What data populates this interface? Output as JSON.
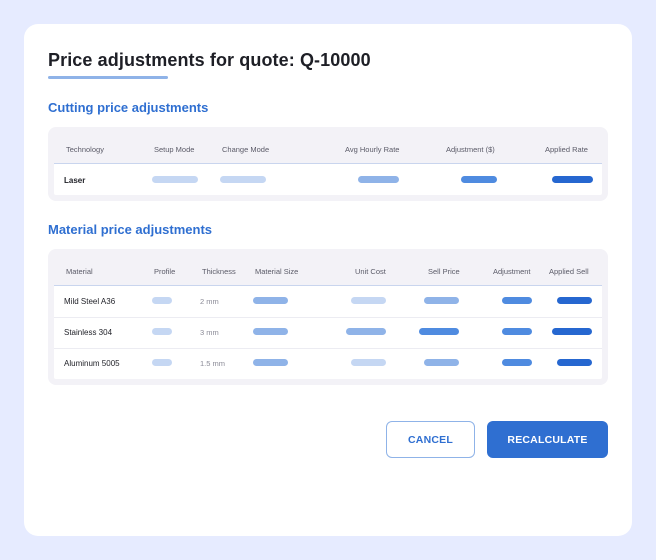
{
  "modal": {
    "title": "Price adjustments for quote: Q-10000"
  },
  "cutting": {
    "section_title": "Cutting price adjustments",
    "headers": [
      "Technology",
      "Setup Mode",
      "Change Mode",
      "Avg Hourly Rate",
      "Adjustment ($)",
      "Applied Rate"
    ],
    "rows": [
      {
        "technology": "Laser"
      }
    ]
  },
  "material": {
    "section_title": "Material price adjustments",
    "headers": [
      "Material",
      "Profile",
      "Thickness",
      "Material Size",
      "Unit Cost",
      "Sell Price",
      "Adjustment",
      "Applied Sell"
    ],
    "rows": [
      {
        "material": "Mild Steel A36",
        "thickness": "2 mm"
      },
      {
        "material": "Stainless 304",
        "thickness": "3 mm"
      },
      {
        "material": "Aluminum 5005",
        "thickness": "1.5 mm"
      }
    ]
  },
  "actions": {
    "cancel_label": "CANCEL",
    "recalculate_label": "RECALCULATE"
  },
  "colors": {
    "background": "#e6ebff",
    "accent": "#2f6fd1",
    "placeholder_light": "#c5d7f3",
    "placeholder_mid": "#8fb3e8",
    "placeholder_strong": "#4f8be0",
    "placeholder_dark": "#2667d0"
  }
}
